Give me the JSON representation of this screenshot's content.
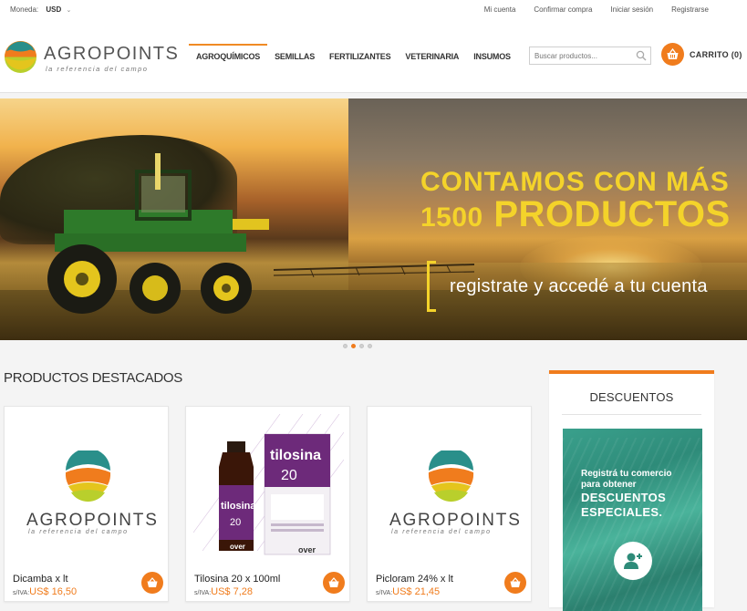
{
  "topbar": {
    "currency_label": "Moneda:",
    "currency_value": "USD",
    "links": [
      "Mi cuenta",
      "Confirmar compra",
      "Iniciar sesión",
      "Registrarse"
    ]
  },
  "header": {
    "logo_name": "AGROPOINTS",
    "logo_tagline": "la referencia del campo",
    "nav": [
      "AGROQUÍMICOS",
      "SEMILLAS",
      "FERTILIZANTES",
      "VETERINARIA",
      "INSUMOS"
    ],
    "active_nav": "AGROQUÍMICOS",
    "search_placeholder": "Buscar productos...",
    "cart_label": "CARRITO (0)"
  },
  "hero": {
    "line1": "CONTAMOS CON MÁS",
    "line2_num": "1500",
    "line2_text": "PRODUCTOS",
    "subline": "registrate y accedé a tu cuenta",
    "slides": 4,
    "active_slide": 2
  },
  "products": {
    "section_title": "PRODUCTOS DESTACADOS",
    "items": [
      {
        "name": "Dicamba x lt",
        "price_prefix": "s/IVA:",
        "price": "US$ 16,50",
        "image": "logo"
      },
      {
        "name": "Tilosina 20 x 100ml",
        "price_prefix": "s/IVA:",
        "price": "US$ 7,28",
        "image": "product"
      },
      {
        "name": "Picloram 24% x lt",
        "price_prefix": "s/IVA:",
        "price": "US$ 21,45",
        "image": "logo"
      }
    ]
  },
  "product_image": {
    "brand": "tilosina",
    "strength": "20",
    "maker": "over"
  },
  "sidebar": {
    "title": "DESCUENTOS",
    "promo_line1": "Registrá tu comercio",
    "promo_line2": "para obtener",
    "promo_line3": "DESCUENTOS",
    "promo_line4": "ESPECIALES."
  },
  "colors": {
    "accent": "#f07c1d",
    "hero_text": "#f4d32a",
    "promo_green": "#2e8b79"
  },
  "icons": {
    "search": "search-icon",
    "cart": "basket-icon",
    "add_user": "add-user-icon"
  }
}
